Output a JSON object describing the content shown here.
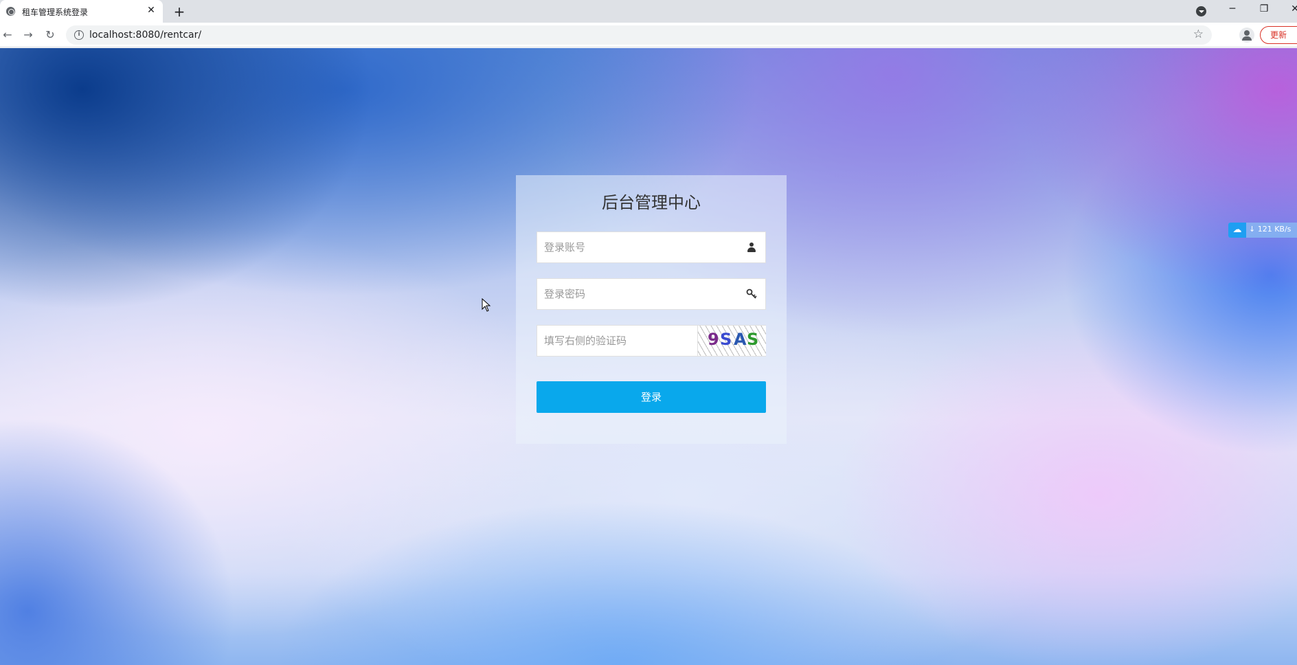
{
  "browser": {
    "tab_title": "租车管理系统登录",
    "tab_close": "✕",
    "new_tab": "+",
    "url": "localhost:8080/rentcar/",
    "update_label": "更新",
    "minimize": "─",
    "restore": "❐",
    "close": "✕"
  },
  "login": {
    "title": "后台管理中心",
    "username_placeholder": "登录账号",
    "password_placeholder": "登录密码",
    "captcha_placeholder": "填写右侧的验证码",
    "captcha_chars": [
      "9",
      "S",
      "A",
      "S"
    ],
    "captcha_colors": [
      "#7a2a8a",
      "#3a4bd0",
      "#2a58b0",
      "#2e9a2e"
    ],
    "submit_label": "登录"
  },
  "net_speed": {
    "rate": "↓ 121 KB/s"
  },
  "colors": {
    "primary_button": "#09a8ec",
    "update_red": "#d93025"
  }
}
